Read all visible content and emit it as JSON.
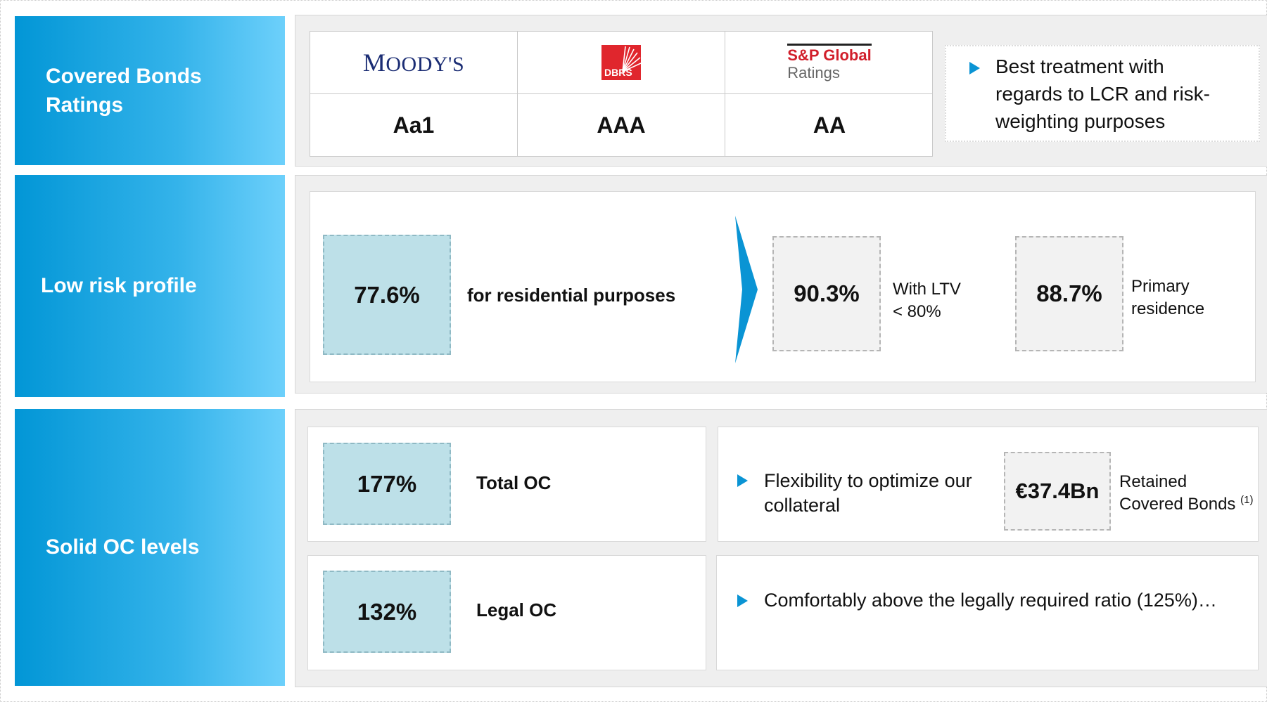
{
  "sections": {
    "ratings": {
      "title": "Covered Bonds Ratings",
      "agencies": [
        {
          "name": "MOODY'S",
          "logo_first": "M",
          "logo_rest": "OODY'S",
          "grade": "Aa1"
        },
        {
          "name": "DBRS",
          "grade": "AAA"
        },
        {
          "name_line1": "S&P Global",
          "name_line2": "Ratings",
          "grade": "AA"
        }
      ],
      "note": "Best treatment with regards to LCR and risk-weighting purposes"
    },
    "risk": {
      "title": "Low risk profile",
      "main_value": "77.6%",
      "main_text": "for residential purposes",
      "ltv_value": "90.3%",
      "ltv_text_1": "With LTV",
      "ltv_text_2": "< 80%",
      "primary_value": "88.7%",
      "primary_text_1": "Primary",
      "primary_text_2": "residence"
    },
    "oc": {
      "title": "Solid OC levels",
      "total_value": "177%",
      "total_label": "Total OC",
      "legal_value": "132%",
      "legal_label": "Legal OC",
      "flex_text_1": "Flexibility to optimize our",
      "flex_text_2": "collateral",
      "retained_value": "€37.4Bn",
      "retained_text_1": "Retained",
      "retained_text_2": "Covered Bonds",
      "retained_note": "(1)",
      "comfort_text": "Comfortably above the legally required ratio (125%)…"
    }
  },
  "colors": {
    "accent": "#0a94d4",
    "label_gradient_start": "#0296d6",
    "label_gradient_end": "#6dd0fb",
    "tile_blue": "#bde0e8",
    "tile_grey": "#f2f2f2",
    "sp_red": "#d11f2b",
    "moodys_blue": "#1b2d74",
    "dbrs_red": "#e0262d"
  }
}
